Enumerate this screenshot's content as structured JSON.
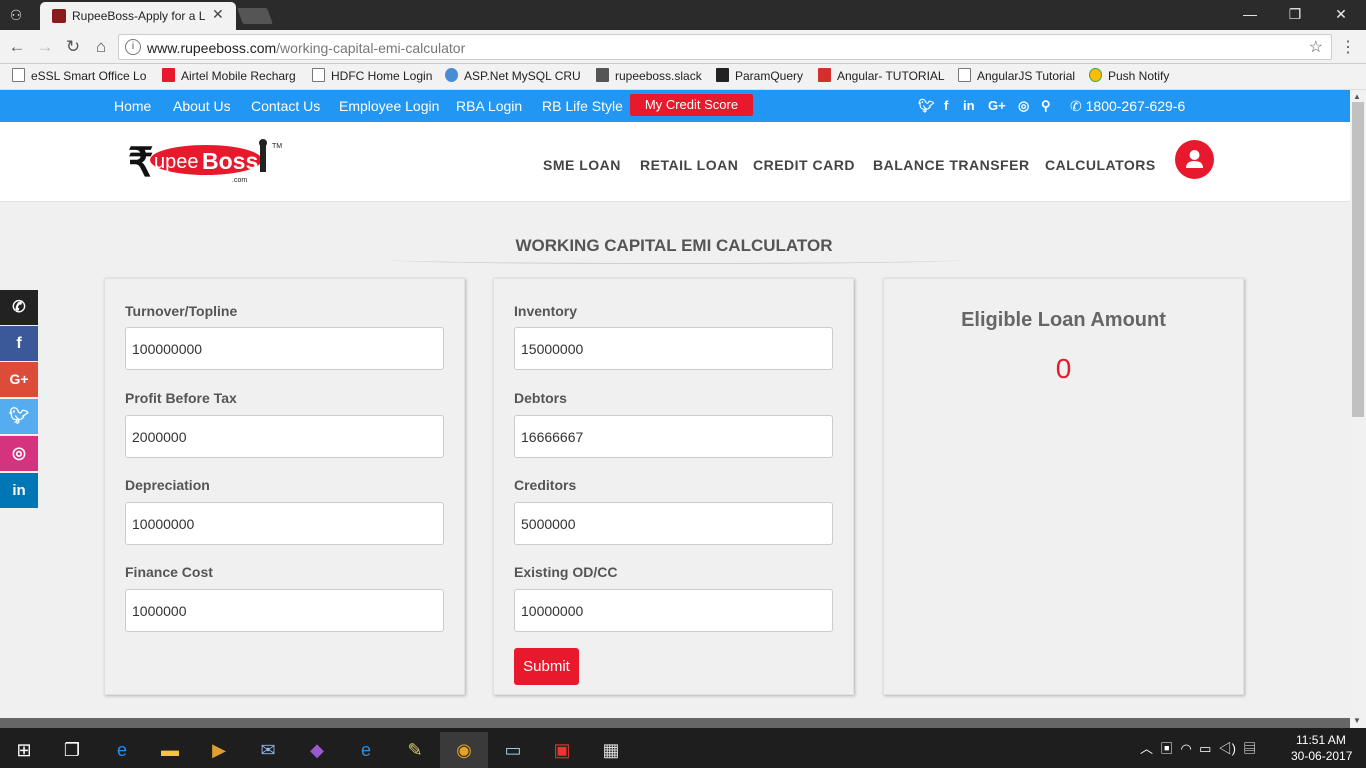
{
  "browser": {
    "tab_title": "RupeeBoss-Apply for a L",
    "tab_close": "✕",
    "url_domain": "www.rupeeboss.com",
    "url_path": "/working-capital-emi-calculator",
    "bookmarks": [
      "eSSL Smart Office Lo",
      "Airtel Mobile Recharg",
      "HDFC Home Login",
      "ASP.Net MySQL CRUI",
      "rupeeboss.slack",
      "ParamQuery",
      "Angular- TUTORIAL",
      "AngularJS Tutorial",
      "Push Notify"
    ]
  },
  "topbar": {
    "links": [
      "Home",
      "About Us",
      "Contact Us",
      "Employee Login",
      "RBA Login",
      "RB Life Style"
    ],
    "credit_score": "My Credit Score",
    "phone": "1800-267-629-6"
  },
  "header": {
    "nav": [
      "SME LOAN",
      "RETAIL LOAN",
      "CREDIT CARD",
      "BALANCE TRANSFER",
      "CALCULATORS"
    ]
  },
  "calculator": {
    "title": "WORKING CAPITAL EMI CALCULATOR",
    "left": [
      {
        "label": "Turnover/Topline",
        "value": "100000000"
      },
      {
        "label": "Profit Before Tax",
        "value": "2000000"
      },
      {
        "label": "Depreciation",
        "value": "10000000"
      },
      {
        "label": "Finance Cost",
        "value": "1000000"
      }
    ],
    "middle": [
      {
        "label": "Inventory",
        "value": "15000000"
      },
      {
        "label": "Debtors",
        "value": "16666667"
      },
      {
        "label": "Creditors",
        "value": "5000000"
      },
      {
        "label": "Existing OD/CC",
        "value": "10000000"
      }
    ],
    "submit": "Submit",
    "result_label": "Eligible Loan Amount",
    "result_value": "0"
  },
  "taskbar": {
    "time": "11:51 AM",
    "date": "30-06-2017"
  },
  "colors": {
    "brand_blue": "#2196f3",
    "brand_red": "#e8192c",
    "share_phone": "#222222",
    "share_facebook": "#3b5998",
    "share_google": "#dd4b39",
    "share_twitter": "#55acee",
    "share_instagram": "#d6337f",
    "share_linkedin": "#0077b5"
  }
}
